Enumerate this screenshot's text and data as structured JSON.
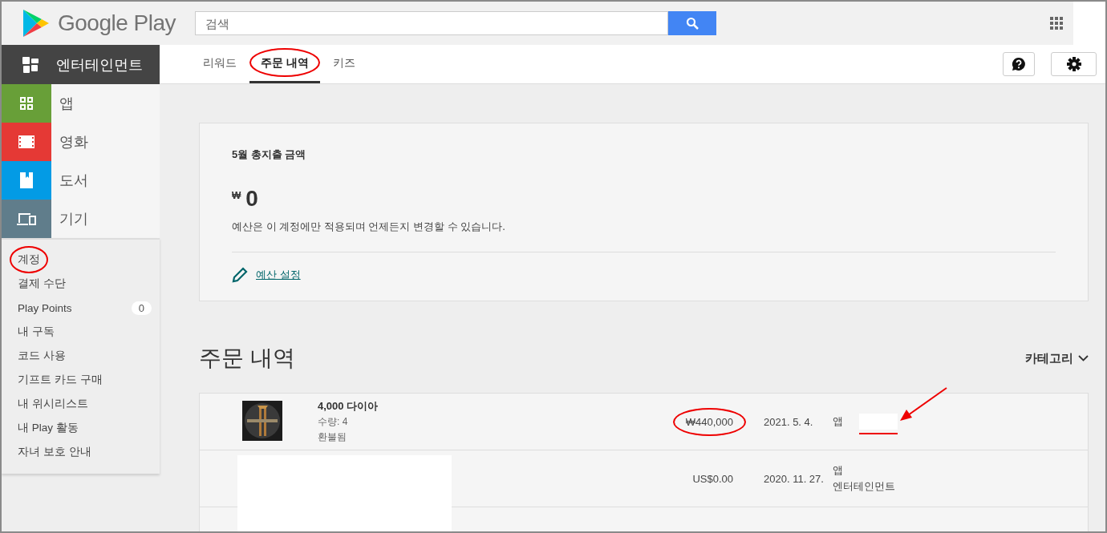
{
  "header": {
    "brand": "Google Play",
    "search": {
      "placeholder": "검색"
    }
  },
  "section": {
    "title": "엔터테인먼트"
  },
  "tabs": [
    {
      "label": "리워드",
      "selected": false,
      "circled": false
    },
    {
      "label": "주문 내역",
      "selected": true,
      "circled": true
    },
    {
      "label": "키즈",
      "selected": false,
      "circled": false
    }
  ],
  "sidebar": {
    "categories": [
      {
        "kind": "apps",
        "label": "앱",
        "color": "#689f38"
      },
      {
        "kind": "movies",
        "label": "영화",
        "color": "#e53935"
      },
      {
        "kind": "books",
        "label": "도서",
        "color": "#039be5"
      },
      {
        "kind": "devices",
        "label": "기기",
        "color": "#607d8b"
      }
    ],
    "links": [
      {
        "label": "계정",
        "circled": true
      },
      {
        "label": "결제 수단",
        "circled": false
      },
      {
        "label": "Play Points",
        "badge": "0",
        "circled": false
      },
      {
        "label": "내 구독",
        "circled": false
      },
      {
        "label": "코드 사용",
        "circled": false
      },
      {
        "label": "기프트 카드 구매",
        "circled": false
      },
      {
        "label": "내 위시리스트",
        "circled": false
      },
      {
        "label": "내 Play 활동",
        "circled": false
      },
      {
        "label": "자녀 보호 안내",
        "circled": false
      }
    ]
  },
  "budget": {
    "title": "5월 총지출 금액",
    "currency": "₩",
    "amount": "0",
    "note": "예산은 이 계정에만 적용되며 언제든지 변경할 수 있습니다.",
    "link": "예산 설정"
  },
  "orders": {
    "title": "주문 내역",
    "filter": "카테고리",
    "rows": [
      {
        "product": "4,000 다이아",
        "quantity": "수량: 4",
        "status": "환불됨",
        "price": "₩440,000",
        "price_circled": true,
        "date": "2021. 5. 4.",
        "categories": [
          "앱"
        ],
        "pointed": true,
        "product_redacted": false
      },
      {
        "price": "US$0.00",
        "price_circled": false,
        "date": "2020. 11. 27.",
        "categories": [
          "앱",
          "엔터테인먼트"
        ],
        "pointed": false,
        "product_redacted": true
      }
    ]
  }
}
